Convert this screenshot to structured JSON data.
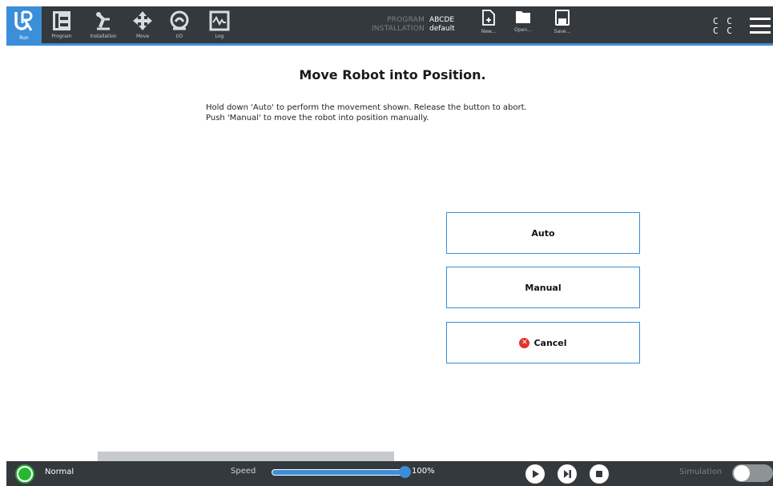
{
  "topbar": {
    "nav": [
      {
        "id": "run",
        "label": "Run",
        "icon": "ur-logo-icon"
      },
      {
        "id": "program",
        "label": "Program",
        "icon": "program-icon"
      },
      {
        "id": "installation",
        "label": "Installation",
        "icon": "robot-arm-icon"
      },
      {
        "id": "move",
        "label": "Move",
        "icon": "move-arrows-icon"
      },
      {
        "id": "io",
        "label": "I/O",
        "icon": "io-icon"
      },
      {
        "id": "log",
        "label": "Log",
        "icon": "log-icon"
      }
    ],
    "program_key": "PROGRAM",
    "program_value": "ABCDE",
    "installation_key": "INSTALLATION",
    "installation_value": "default",
    "new_label": "New...",
    "open_label": "Open...",
    "save_label": "Save...",
    "cc_line1": "C C",
    "cc_line2": "C C"
  },
  "content": {
    "title": "Move Robot into Position.",
    "instruction_line1": "Hold down 'Auto' to perform the movement shown. Release the button to abort.",
    "instruction_line2": "Push 'Manual' to move the robot into position manually.",
    "auto_label": "Auto",
    "manual_label": "Manual",
    "cancel_label": "Cancel"
  },
  "bottombar": {
    "status": "Normal",
    "status_color": "#26b92f",
    "speed_label": "Speed",
    "speed_value": "100%",
    "speed_fraction": 1.0,
    "simulation_label": "Simulation",
    "simulation_on": false
  },
  "colors": {
    "accent": "#3b8ed8",
    "bar_bg": "#34393d",
    "cancel_red": "#e0332f"
  }
}
